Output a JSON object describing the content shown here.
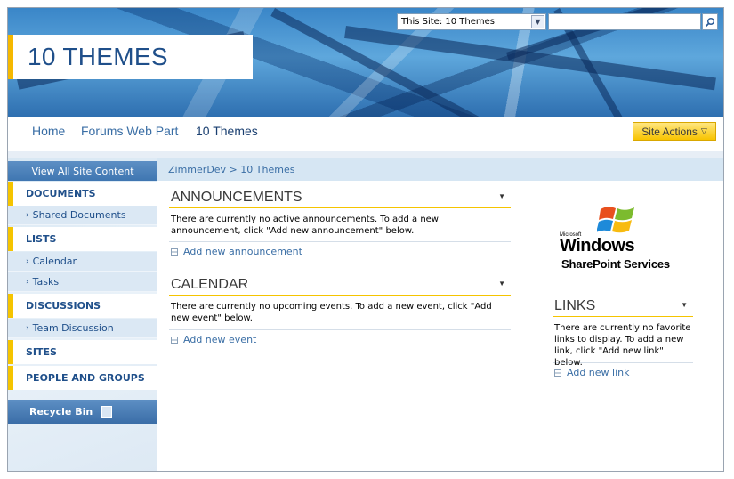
{
  "search": {
    "scope_value": "This Site: 10 Themes"
  },
  "site": {
    "title": "10 THEMES"
  },
  "topnav": {
    "items": [
      "Home",
      "Forums Web Part",
      "10 Themes"
    ],
    "site_actions_label": "Site Actions"
  },
  "leftnav": {
    "view_all": "View All Site Content",
    "documents": "DOCUMENTS",
    "shared_documents": "Shared Documents",
    "lists": "LISTS",
    "calendar": "Calendar",
    "tasks": "Tasks",
    "discussions": "DISCUSSIONS",
    "team_discussion": "Team Discussion",
    "sites": "SITES",
    "people_groups": "PEOPLE AND GROUPS",
    "recycle_bin": "Recycle Bin"
  },
  "breadcrumb": "ZimmerDev > 10 Themes",
  "announcements": {
    "title": "ANNOUNCEMENTS",
    "empty_text": "There are currently no active announcements. To add a new announcement, click \"Add new announcement\" below.",
    "add_link": "Add new announcement"
  },
  "calendar": {
    "title": "CALENDAR",
    "empty_text": "There are currently no upcoming events. To add a new event, click \"Add new event\" below.",
    "add_link": "Add new event"
  },
  "links": {
    "title": "LINKS",
    "empty_text": "There are currently no favorite links to display. To add a new link, click \"Add new link\" below.",
    "add_link": "Add new link"
  },
  "logo": {
    "microsoft": "Microsoft",
    "windows": "Windows",
    "product": "SharePoint Services"
  },
  "colors": {
    "accent_yellow": "#f5c400",
    "link_blue": "#3a6ea5",
    "title_blue": "#1f4f8a",
    "nav_blue": "#3f76b1"
  }
}
